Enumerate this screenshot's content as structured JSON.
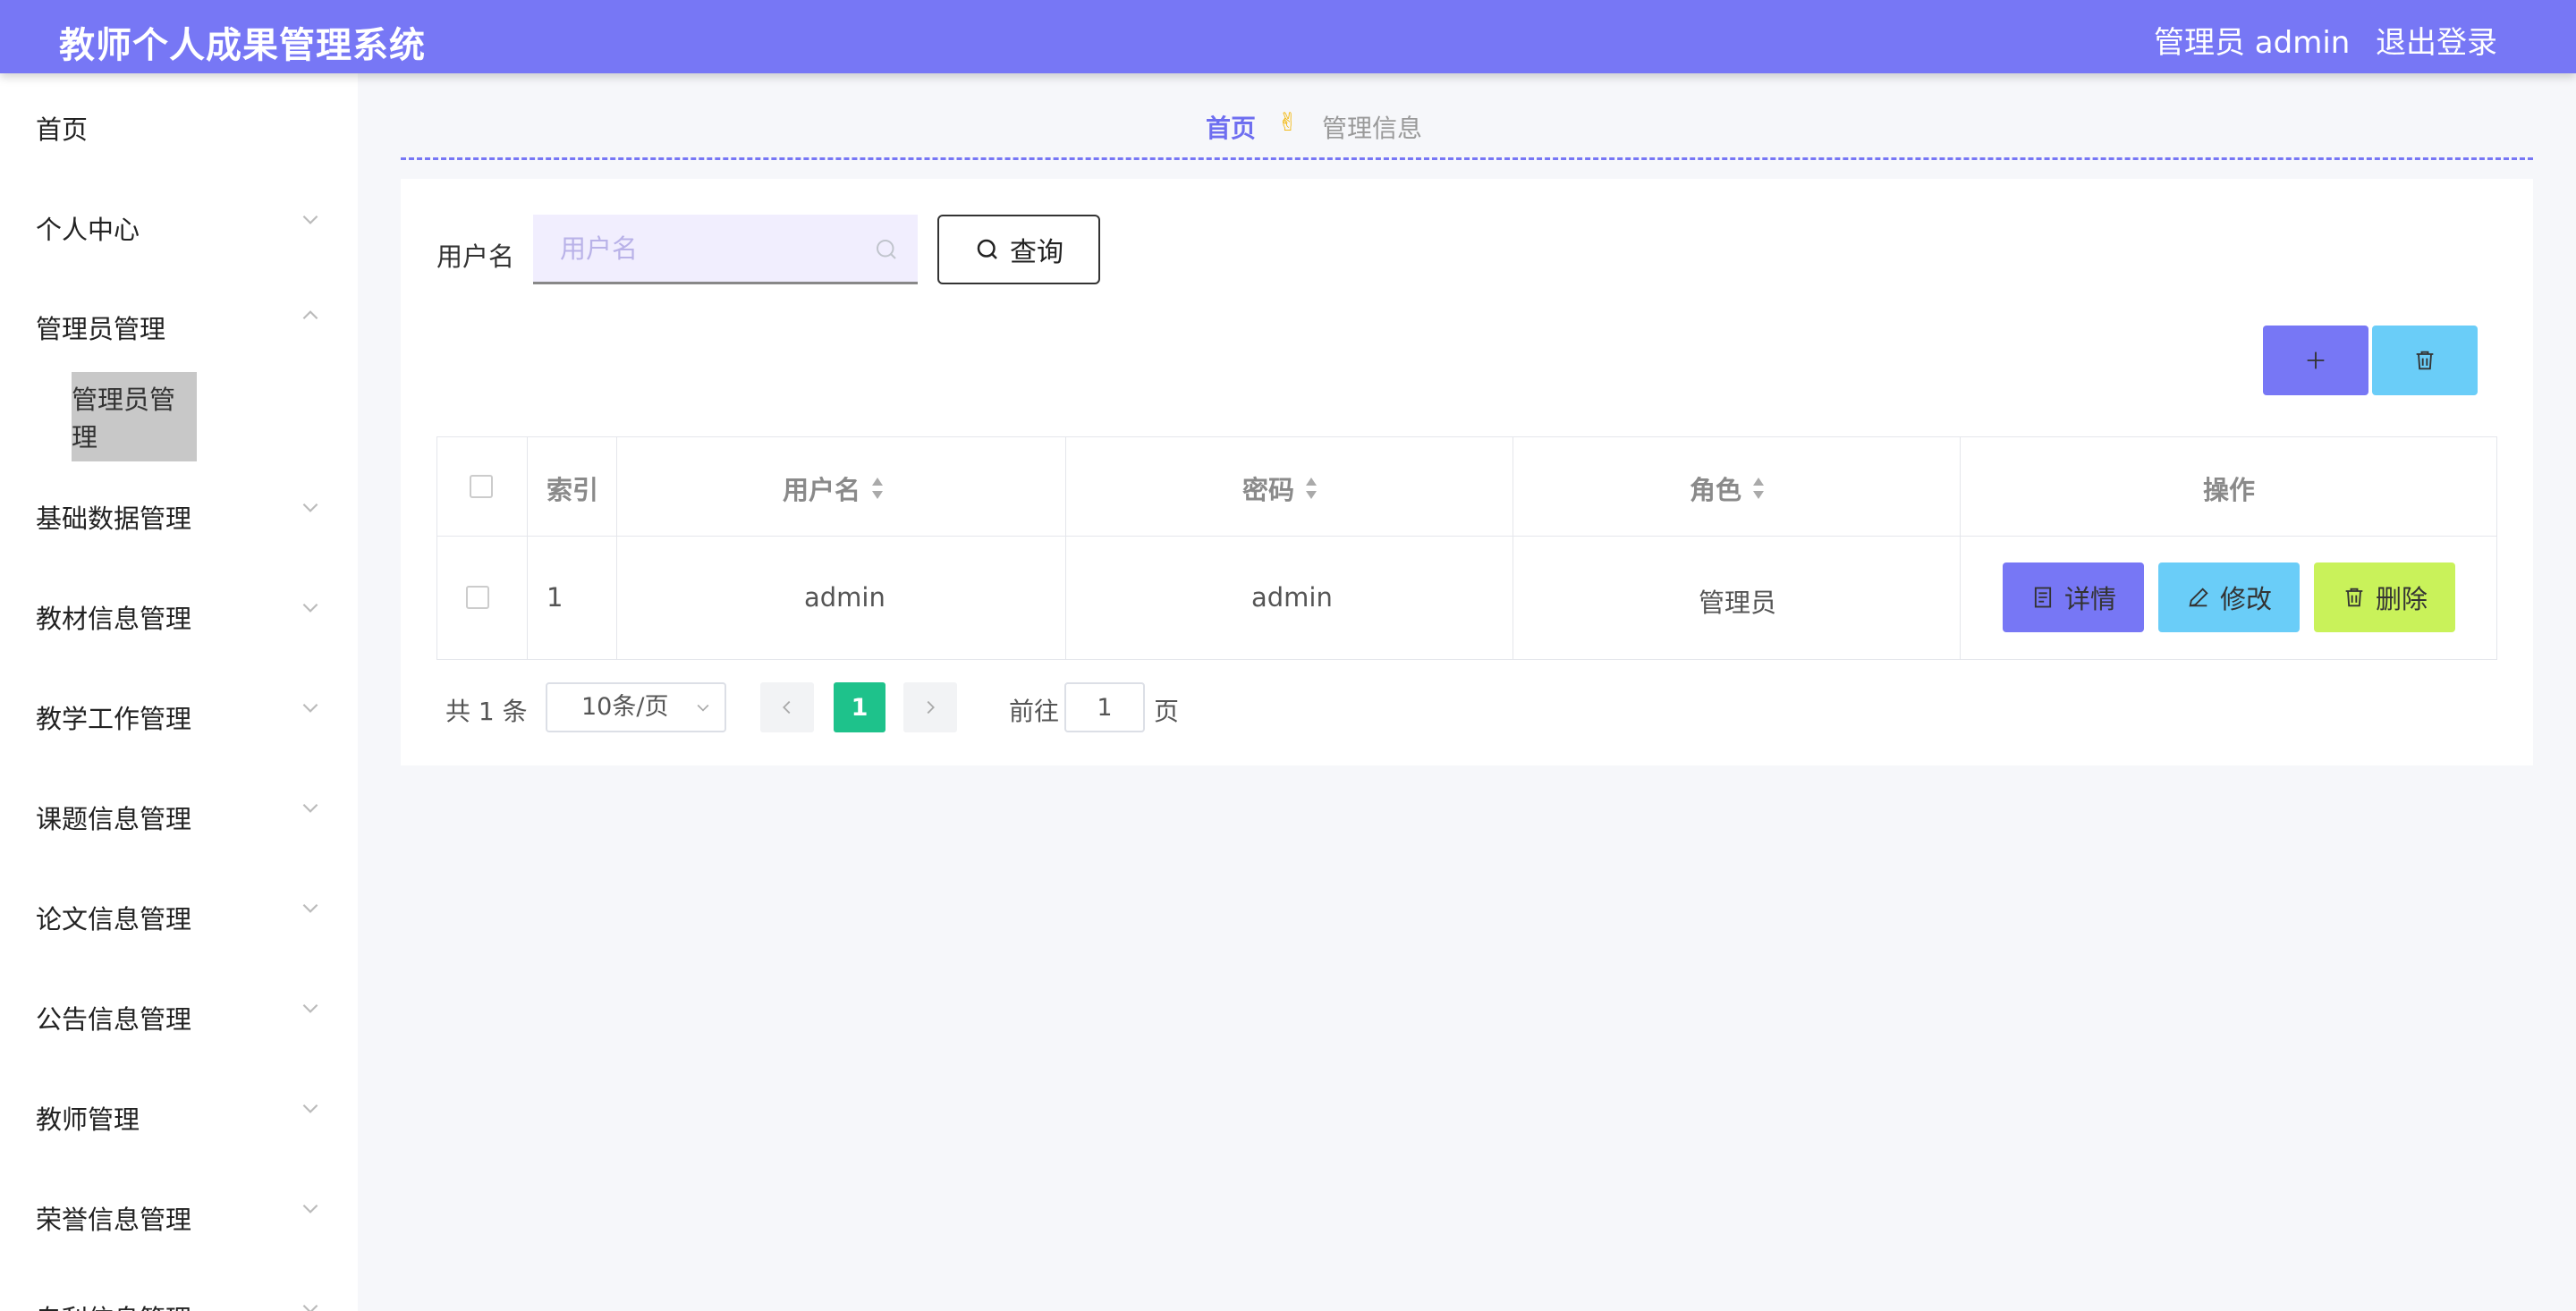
{
  "header": {
    "app_title": "教师个人成果管理系统",
    "user_info": "管理员 admin",
    "logout": "退出登录",
    "accent_color": "#7777f5"
  },
  "sidebar": {
    "items": [
      {
        "label": "首页",
        "expandable": false
      },
      {
        "label": "个人中心",
        "expandable": true,
        "state": "collapsed"
      },
      {
        "label": "管理员管理",
        "expandable": true,
        "state": "expanded"
      },
      {
        "label": "基础数据管理",
        "expandable": true,
        "state": "collapsed"
      },
      {
        "label": "教材信息管理",
        "expandable": true,
        "state": "collapsed"
      },
      {
        "label": "教学工作管理",
        "expandable": true,
        "state": "collapsed"
      },
      {
        "label": "课题信息管理",
        "expandable": true,
        "state": "collapsed"
      },
      {
        "label": "论文信息管理",
        "expandable": true,
        "state": "collapsed"
      },
      {
        "label": "公告信息管理",
        "expandable": true,
        "state": "collapsed"
      },
      {
        "label": "教师管理",
        "expandable": true,
        "state": "collapsed"
      },
      {
        "label": "荣誉信息管理",
        "expandable": true,
        "state": "collapsed"
      },
      {
        "label": "专利信息管理",
        "expandable": true,
        "state": "collapsed"
      }
    ],
    "active_subitem": "管理员管理"
  },
  "breadcrumb": {
    "home": "首页",
    "separator": "✌",
    "current": "管理信息"
  },
  "search": {
    "label": "用户名",
    "placeholder": "用户名",
    "value": "",
    "query_button": "查询"
  },
  "toolbar": {
    "add_icon": "plus-icon",
    "batch_delete_icon": "trash-icon"
  },
  "table": {
    "columns": [
      "索引",
      "用户名",
      "密码",
      "角色",
      "操作"
    ],
    "sortable": [
      "用户名",
      "密码",
      "角色"
    ],
    "rows": [
      {
        "index": "1",
        "username": "admin",
        "password": "admin",
        "role": "管理员"
      }
    ],
    "actions": [
      {
        "label": "详情",
        "icon": "document-icon",
        "color": "#7777f5"
      },
      {
        "label": "修改",
        "icon": "pencil-icon",
        "color": "#6acdf8"
      },
      {
        "label": "删除",
        "icon": "trash-icon",
        "color": "#c9f25a"
      }
    ]
  },
  "pagination": {
    "total": "共 1 条",
    "page_size": "10条/页",
    "current_page": "1",
    "goto_label": "前往",
    "goto_value": "1",
    "goto_suffix": "页",
    "active_color": "#1ec28b"
  }
}
